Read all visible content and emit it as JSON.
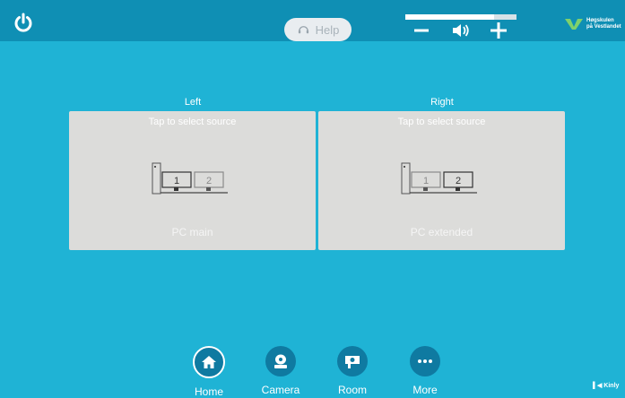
{
  "topbar": {
    "help_label": "Help",
    "volume_level": 0.8,
    "brand_line1": "Høgskulen",
    "brand_line2": "på Vestlandet"
  },
  "screens": [
    {
      "label": "Left",
      "hint": "Tap to select source",
      "source": "PC main",
      "highlight": 1
    },
    {
      "label": "Right",
      "hint": "Tap to select source",
      "source": "PC extended",
      "highlight": 2
    }
  ],
  "nav": {
    "items": [
      {
        "label": "Home",
        "icon": "home-icon"
      },
      {
        "label": "Camera",
        "icon": "camera-icon"
      },
      {
        "label": "Room",
        "icon": "room-icon"
      },
      {
        "label": "More",
        "icon": "more-icon"
      }
    ]
  },
  "footer": {
    "kinly": "Kinly"
  }
}
